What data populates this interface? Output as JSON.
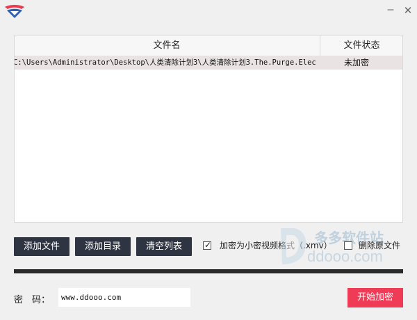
{
  "titlebar": {
    "minimize_glyph": "─",
    "close_glyph": "✕"
  },
  "table": {
    "columns": [
      "文件名",
      "文件状态"
    ],
    "rows": [
      {
        "name": "C:\\Users\\Administrator\\Desktop\\人类清除计划3\\人类清除计划3.The.Purge.Elec",
        "status": "未加密"
      }
    ]
  },
  "actions": {
    "add_file": "添加文件",
    "add_dir": "添加目录",
    "clear_list": "清空列表"
  },
  "options": {
    "encrypt_label": "加密为小密视频格式（.xmv）",
    "encrypt_checked": true,
    "delete_label": "删除原文件",
    "delete_checked": false
  },
  "password": {
    "label": "密　码：",
    "value": "www.ddooo.com"
  },
  "start_button": "开始加密",
  "watermark": {
    "line1": "多多软件站",
    "line2": "ddooo.com"
  },
  "colors": {
    "dark_button": "#2e3441",
    "start_button": "#ef3b55",
    "row_highlight": "#e9e3e3"
  }
}
